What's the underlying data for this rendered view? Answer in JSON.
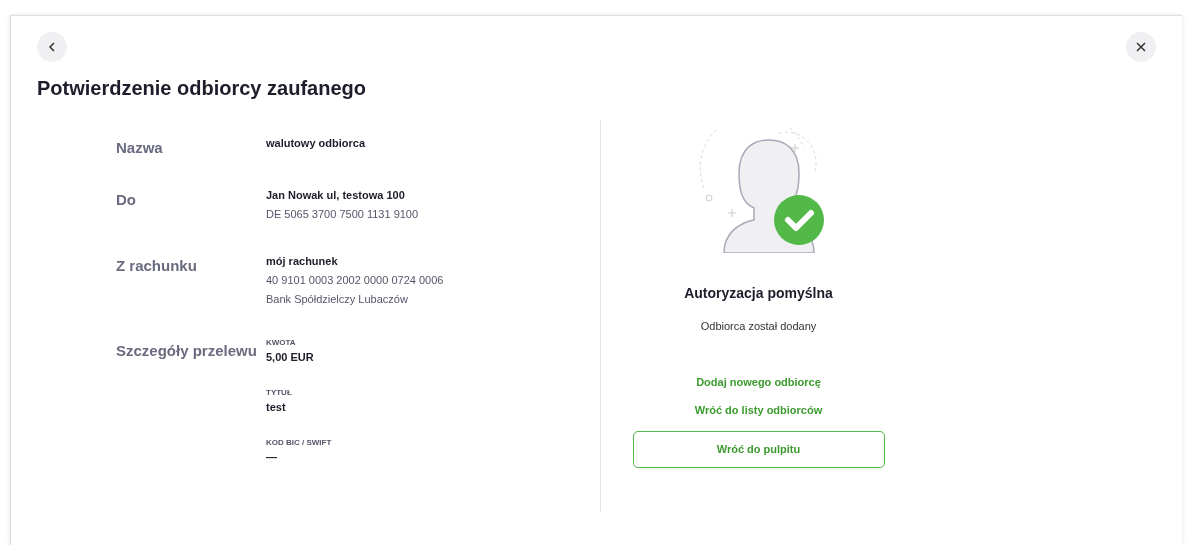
{
  "title": "Potwierdzenie odbiorcy zaufanego",
  "details": [
    {
      "kind": "lines",
      "label": "Nazwa",
      "lines": [
        {
          "text": "walutowy odbiorca",
          "strong": true
        }
      ]
    },
    {
      "kind": "lines",
      "label": "Do",
      "lines": [
        {
          "text": "Jan Nowak ul, testowa 100",
          "strong": true
        },
        {
          "text": "DE 5065 3700 7500 1131 9100",
          "strong": false
        }
      ]
    },
    {
      "kind": "lines",
      "label": "Z rachunku",
      "lines": [
        {
          "text": "mój rachunek",
          "strong": true
        },
        {
          "text": "40 9101 0003 2002 0000 0724 0006",
          "strong": false
        },
        {
          "text": "Bank Spółdzielczy Lubaczów",
          "strong": false
        }
      ]
    },
    {
      "kind": "fields",
      "label": "Szczegóły przelewu",
      "fields": [
        {
          "caption": "KWOTA",
          "value": "5,00 EUR"
        },
        {
          "caption": "TYTUŁ",
          "value": "test"
        },
        {
          "caption": "KOD BIC / SWIFT",
          "value": "—"
        }
      ]
    }
  ],
  "result": {
    "heading": "Autoryzacja pomyślna",
    "message": "Odbiorca został dodany",
    "links": [
      "Dodaj nowego odbiorcę",
      "Wróć do listy odbiorców"
    ],
    "button": "Wróć do pulpitu"
  }
}
